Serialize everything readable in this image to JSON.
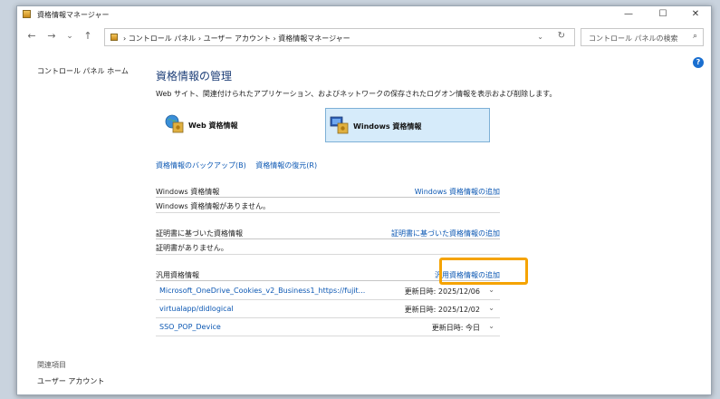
{
  "window": {
    "title": "資格情報マネージャー"
  },
  "titlebar": {
    "minimize": "—",
    "maximize": "☐",
    "close": "✕"
  },
  "nav": {
    "back": "←",
    "forward": "→",
    "history": "⌄",
    "up": "↑",
    "breadcrumb": "›  コントロール パネル  ›  ユーザー アカウント  ›  資格情報マネージャー",
    "dropdown": "⌄",
    "refresh": "↻",
    "search_placeholder": "コントロール パネルの検索",
    "search_icon": "⌕"
  },
  "sidebar": {
    "home": "コントロール パネル ホーム",
    "related_heading": "関連項目",
    "related_link": "ユーザー アカウント"
  },
  "help_label": "?",
  "main": {
    "title": "資格情報の管理",
    "description": "Web サイト、関連付けられたアプリケーション、およびネットワークの保存されたログオン情報を表示および削除します。",
    "tiles": [
      {
        "label": "Web 資格情報",
        "icon": "globe-safe-icon"
      },
      {
        "label": "Windows 資格情報",
        "icon": "computer-safe-icon",
        "selected": true
      }
    ],
    "backup_link": "資格情報のバックアップ(B)",
    "restore_link": "資格情報の復元(R)"
  },
  "sections": {
    "windows": {
      "heading": "Windows 資格情報",
      "add": "Windows 資格情報の追加",
      "empty": "Windows 資格情報がありません。"
    },
    "certificate": {
      "heading": "証明書に基づいた資格情報",
      "add": "証明書に基づいた資格情報の追加",
      "empty": "証明書がありません。"
    },
    "generic": {
      "heading": "汎用資格情報",
      "add": "汎用資格情報の追加",
      "items": [
        {
          "name": "Microsoft_OneDrive_Cookies_v2_Business1_https://fujit...",
          "date": "更新日時: 2025/12/06"
        },
        {
          "name": "virtualapp/didlogical",
          "date": "更新日時: 2025/12/02"
        },
        {
          "name": "SSO_POP_Device",
          "date": "更新日時: 今日"
        }
      ]
    }
  },
  "colors": {
    "accent_link": "#0b57b3",
    "title": "#1e3f78",
    "highlight": "#f5a300",
    "selected_tile": "#d6ebfa"
  }
}
